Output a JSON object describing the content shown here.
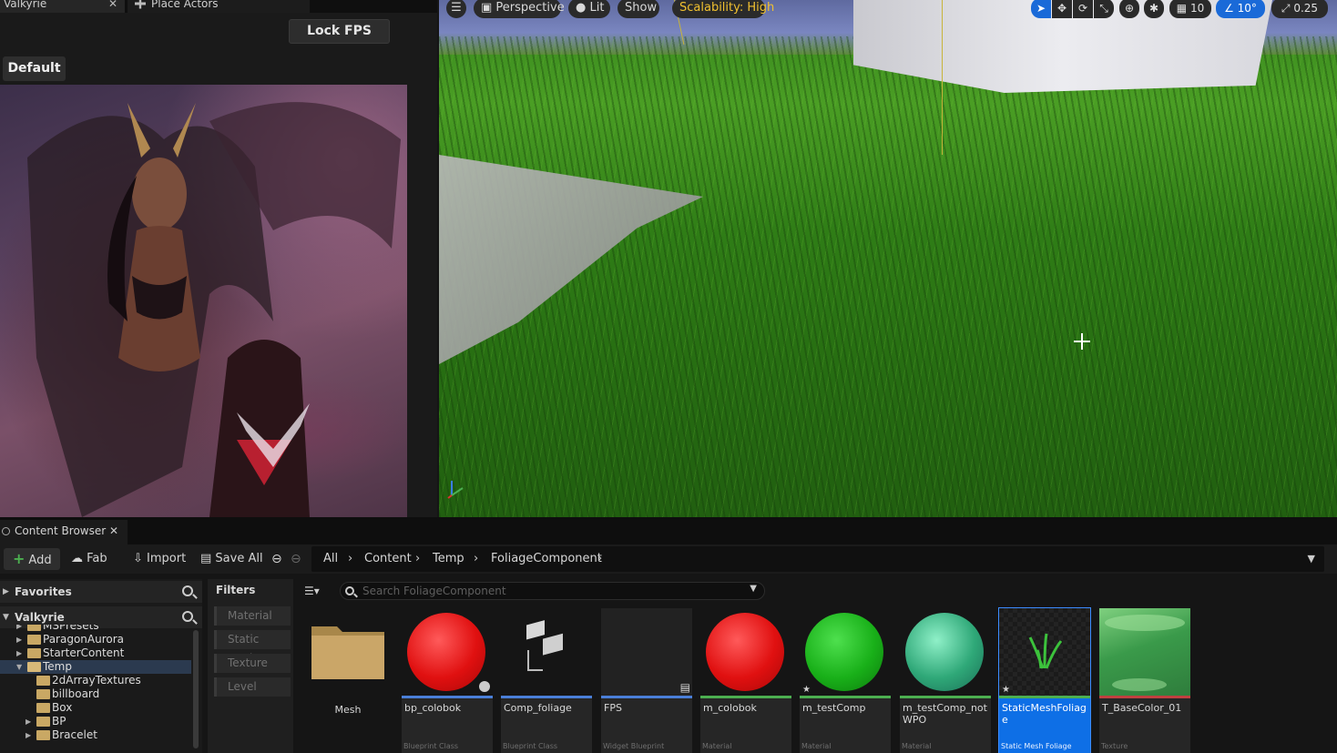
{
  "tabs": {
    "level_tab": "Valkyrie",
    "place_actors": "Place Actors"
  },
  "left_panel": {
    "lock_fps_label": "Lock FPS",
    "default_tab": "Default"
  },
  "viewport": {
    "menu_icon": "hamburger-icon",
    "perspective": "Perspective",
    "lit": "Lit",
    "show": "Show",
    "scalability": "Scalability: High",
    "grid_snap": "10",
    "rotation_snap": "10°",
    "scale_snap": "0.25",
    "accent": "#1a6ad8",
    "scalability_color": "#f0c030"
  },
  "content_browser": {
    "tab_label": "Content Browser",
    "toolbar": {
      "add": "Add",
      "fab": "Fab",
      "import": "Import",
      "save_all": "Save All"
    },
    "breadcrumb": [
      "All",
      "Content",
      "Temp",
      "FoliageComponent"
    ],
    "sources": {
      "favorites": "Favorites",
      "project": "Valkyrie",
      "tree": [
        {
          "label": "MSPresets",
          "indent": 1
        },
        {
          "label": "ParagonAurora",
          "indent": 1
        },
        {
          "label": "StarterContent",
          "indent": 1
        },
        {
          "label": "Temp",
          "indent": 1,
          "selected": true
        },
        {
          "label": "2dArrayTextures",
          "indent": 2
        },
        {
          "label": "billboard",
          "indent": 2
        },
        {
          "label": "Box",
          "indent": 2
        },
        {
          "label": "BP",
          "indent": 2
        },
        {
          "label": "Bracelet",
          "indent": 2
        }
      ]
    },
    "filters": {
      "title": "Filters",
      "items": [
        "Material",
        "Static Mesh",
        "Texture",
        "Level"
      ]
    },
    "search": {
      "placeholder": "Search FoliageComponent"
    },
    "assets": [
      {
        "name": "Mesh",
        "type": "",
        "kind": "folder"
      },
      {
        "name": "bp_colobok",
        "type": "Blueprint Class",
        "kind": "red-ball",
        "bar": "#4a7fd8"
      },
      {
        "name": "Comp_foliage",
        "type": "Blueprint Class",
        "kind": "component",
        "bar": "#4a7fd8"
      },
      {
        "name": "FPS",
        "type": "Widget Blueprint",
        "kind": "widget",
        "bar": "#4a7fd8"
      },
      {
        "name": "m_colobok",
        "type": "Material",
        "kind": "red-ball",
        "bar": "#4caf50"
      },
      {
        "name": "m_testComp",
        "type": "Material",
        "kind": "green-ball",
        "bar": "#4caf50"
      },
      {
        "name": "m_testComp_notWPO",
        "type": "Material",
        "kind": "teal-ball",
        "bar": "#4caf50"
      },
      {
        "name": "StaticMeshFoliage",
        "type": "Static Mesh Foliage",
        "kind": "grass",
        "bar": "#4caf50",
        "selected": true
      },
      {
        "name": "T_BaseColor_01",
        "type": "Texture",
        "kind": "texture",
        "bar": "#c04040"
      }
    ]
  }
}
